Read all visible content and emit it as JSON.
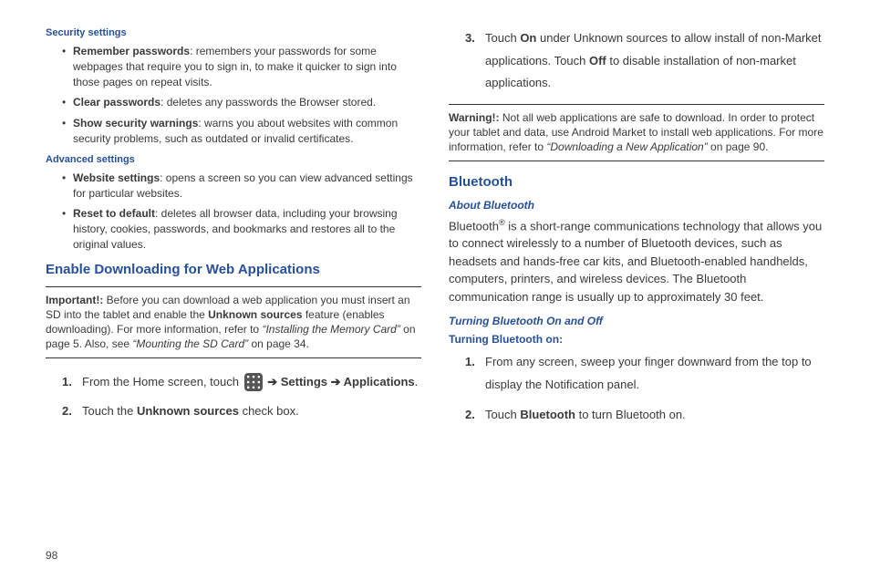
{
  "left": {
    "sec_heading": "Security settings",
    "sec_bullets": [
      {
        "bold": "Remember passwords",
        "text": ": remembers your passwords for some webpages that require you to sign in, to make it quicker to sign into those pages on repeat visits."
      },
      {
        "bold": "Clear passwords",
        "text": ": deletes any passwords the Browser stored."
      },
      {
        "bold": "Show security warnings",
        "text": ": warns you about websites with common security problems, such as outdated or invalid certificates."
      }
    ],
    "adv_heading": "Advanced settings",
    "adv_bullets": [
      {
        "bold": "Website settings",
        "text": ": opens a screen so you can view advanced settings for particular websites."
      },
      {
        "bold": "Reset to default",
        "text": ": deletes all browser data, including your browsing history, cookies, passwords, and bookmarks and restores all to the original values."
      }
    ],
    "enable_heading": "Enable Downloading for Web Applications",
    "important_label": "Important!:",
    "important_text1": " Before you can download a web application you must insert an SD into the tablet and enable the ",
    "important_bold": "Unknown sources",
    "important_text2": " feature (enables downloading). For more information, refer to ",
    "important_ref1": "“Installing the Memory Card”",
    "important_text3": "  on page 5. Also, see ",
    "important_ref2": "“Mounting the SD Card”",
    "important_text4": " on page 34.",
    "step1_a": "From the Home screen, touch ",
    "step1_b": " ➔ ",
    "step1_settings": "Settings",
    "step1_c": " ➔ ",
    "step1_apps": "Applications",
    "step1_d": ".",
    "step2_a": "Touch the ",
    "step2_bold": "Unknown sources",
    "step2_b": " check box."
  },
  "right": {
    "step3_a": "Touch ",
    "step3_on": "On",
    "step3_b": " under Unknown sources to allow install of non-Market applications. Touch ",
    "step3_off": "Off",
    "step3_c": " to disable installation of non-market applications.",
    "warning_label": "Warning!:",
    "warning_text1": " Not all web applications are safe to download. In order to protect your tablet and data, use Android Market to install web applications. For more information, refer to ",
    "warning_ref": "“Downloading a New Application”",
    "warning_text2": "  on page 90.",
    "bt_heading": "Bluetooth",
    "bt_about": "About Bluetooth",
    "bt_body_a": "Bluetooth",
    "bt_body_b": " is a short-range communications technology that allows you to connect wirelessly to a number of Bluetooth devices, such as headsets and hands-free car kits, and Bluetooth-enabled handhelds, computers, printers, and wireless devices. The Bluetooth communication range is usually up to approximately 30 feet.",
    "bt_turn_heading": "Turning Bluetooth On and Off",
    "bt_on_heading": "Turning Bluetooth on:",
    "bt_step1": "From any screen, sweep your finger downward from the top to display the Notification panel.",
    "bt_step2_a": "Touch ",
    "bt_step2_bold": "Bluetooth",
    "bt_step2_b": " to turn Bluetooth on."
  },
  "page_number": "98"
}
